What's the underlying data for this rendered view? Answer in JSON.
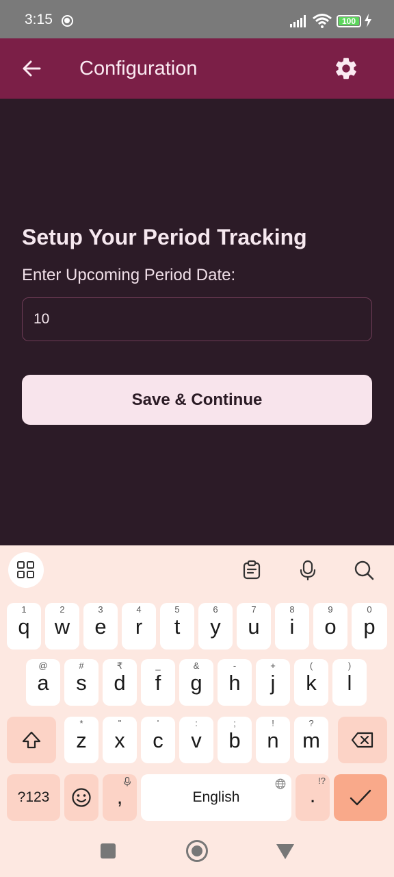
{
  "status_bar": {
    "time": "3:15",
    "battery_level": "100",
    "icons": [
      "sync-icon",
      "signal-icon",
      "wifi-icon",
      "battery-icon",
      "charging-icon"
    ]
  },
  "app_bar": {
    "title": "Configuration",
    "background_color": "#7b1f47",
    "icons": [
      "back-arrow-icon",
      "gear-icon"
    ]
  },
  "main": {
    "heading": "Setup Your Period Tracking",
    "date_label": "Enter Upcoming Period Date:",
    "date_value": "10",
    "save_button_label": "Save & Continue",
    "background_color": "#2c1b27"
  },
  "keyboard": {
    "toolbar_icons": [
      "grid-apps-icon",
      "clipboard-icon",
      "microphone-icon",
      "search-icon"
    ],
    "row1": [
      {
        "letter": "q",
        "hint": "1"
      },
      {
        "letter": "w",
        "hint": "2"
      },
      {
        "letter": "e",
        "hint": "3"
      },
      {
        "letter": "r",
        "hint": "4"
      },
      {
        "letter": "t",
        "hint": "5"
      },
      {
        "letter": "y",
        "hint": "6"
      },
      {
        "letter": "u",
        "hint": "7"
      },
      {
        "letter": "i",
        "hint": "8"
      },
      {
        "letter": "o",
        "hint": "9"
      },
      {
        "letter": "p",
        "hint": "0"
      }
    ],
    "row2": [
      {
        "letter": "a",
        "hint": "@"
      },
      {
        "letter": "s",
        "hint": "#"
      },
      {
        "letter": "d",
        "hint": "₹"
      },
      {
        "letter": "f",
        "hint": "_"
      },
      {
        "letter": "g",
        "hint": "&"
      },
      {
        "letter": "h",
        "hint": "-"
      },
      {
        "letter": "j",
        "hint": "+"
      },
      {
        "letter": "k",
        "hint": "("
      },
      {
        "letter": "l",
        "hint": ")"
      }
    ],
    "row3": [
      {
        "letter": "z",
        "hint": "*"
      },
      {
        "letter": "x",
        "hint": "\""
      },
      {
        "letter": "c",
        "hint": "'"
      },
      {
        "letter": "v",
        "hint": ":"
      },
      {
        "letter": "b",
        "hint": ";"
      },
      {
        "letter": "n",
        "hint": "!"
      },
      {
        "letter": "m",
        "hint": "?"
      }
    ],
    "symbols_label": "?123",
    "comma_label": ",",
    "space_label": "English",
    "period_label": ".",
    "period_hint": "!?",
    "enter_color": "#f9a98a",
    "accent_color": "#fcd3c6"
  },
  "nav_bar": {
    "icons": [
      "recents-square-icon",
      "home-circle-icon",
      "back-triangle-icon"
    ]
  }
}
